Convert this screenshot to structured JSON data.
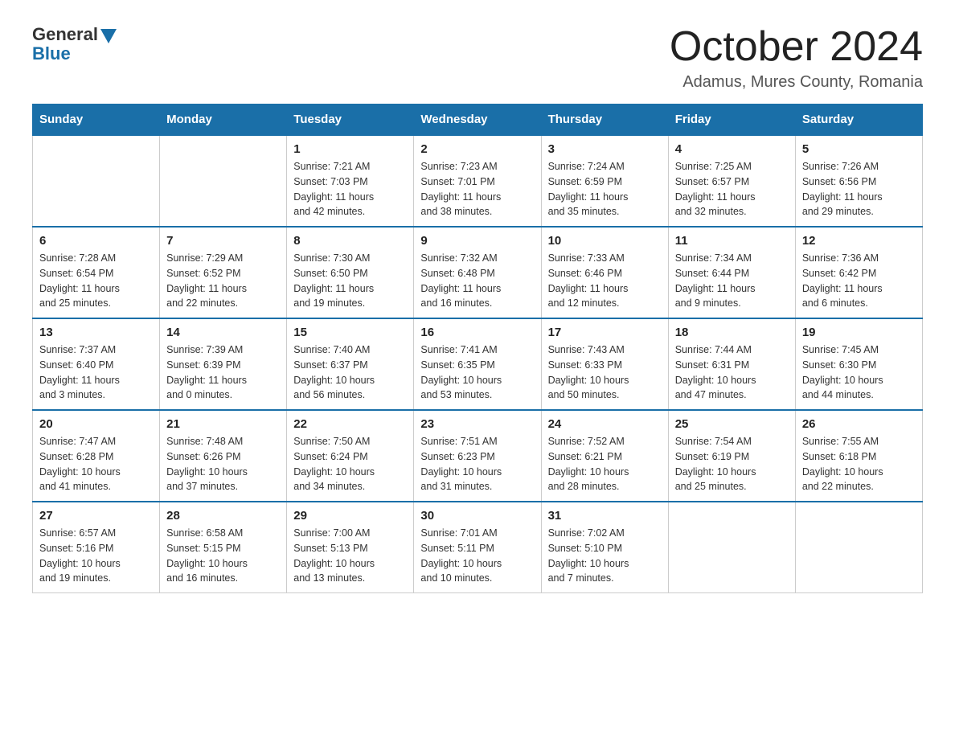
{
  "header": {
    "logo_general": "General",
    "logo_blue": "Blue",
    "title": "October 2024",
    "subtitle": "Adamus, Mures County, Romania"
  },
  "columns": [
    "Sunday",
    "Monday",
    "Tuesday",
    "Wednesday",
    "Thursday",
    "Friday",
    "Saturday"
  ],
  "weeks": [
    [
      {
        "day": "",
        "info": ""
      },
      {
        "day": "",
        "info": ""
      },
      {
        "day": "1",
        "info": "Sunrise: 7:21 AM\nSunset: 7:03 PM\nDaylight: 11 hours\nand 42 minutes."
      },
      {
        "day": "2",
        "info": "Sunrise: 7:23 AM\nSunset: 7:01 PM\nDaylight: 11 hours\nand 38 minutes."
      },
      {
        "day": "3",
        "info": "Sunrise: 7:24 AM\nSunset: 6:59 PM\nDaylight: 11 hours\nand 35 minutes."
      },
      {
        "day": "4",
        "info": "Sunrise: 7:25 AM\nSunset: 6:57 PM\nDaylight: 11 hours\nand 32 minutes."
      },
      {
        "day": "5",
        "info": "Sunrise: 7:26 AM\nSunset: 6:56 PM\nDaylight: 11 hours\nand 29 minutes."
      }
    ],
    [
      {
        "day": "6",
        "info": "Sunrise: 7:28 AM\nSunset: 6:54 PM\nDaylight: 11 hours\nand 25 minutes."
      },
      {
        "day": "7",
        "info": "Sunrise: 7:29 AM\nSunset: 6:52 PM\nDaylight: 11 hours\nand 22 minutes."
      },
      {
        "day": "8",
        "info": "Sunrise: 7:30 AM\nSunset: 6:50 PM\nDaylight: 11 hours\nand 19 minutes."
      },
      {
        "day": "9",
        "info": "Sunrise: 7:32 AM\nSunset: 6:48 PM\nDaylight: 11 hours\nand 16 minutes."
      },
      {
        "day": "10",
        "info": "Sunrise: 7:33 AM\nSunset: 6:46 PM\nDaylight: 11 hours\nand 12 minutes."
      },
      {
        "day": "11",
        "info": "Sunrise: 7:34 AM\nSunset: 6:44 PM\nDaylight: 11 hours\nand 9 minutes."
      },
      {
        "day": "12",
        "info": "Sunrise: 7:36 AM\nSunset: 6:42 PM\nDaylight: 11 hours\nand 6 minutes."
      }
    ],
    [
      {
        "day": "13",
        "info": "Sunrise: 7:37 AM\nSunset: 6:40 PM\nDaylight: 11 hours\nand 3 minutes."
      },
      {
        "day": "14",
        "info": "Sunrise: 7:39 AM\nSunset: 6:39 PM\nDaylight: 11 hours\nand 0 minutes."
      },
      {
        "day": "15",
        "info": "Sunrise: 7:40 AM\nSunset: 6:37 PM\nDaylight: 10 hours\nand 56 minutes."
      },
      {
        "day": "16",
        "info": "Sunrise: 7:41 AM\nSunset: 6:35 PM\nDaylight: 10 hours\nand 53 minutes."
      },
      {
        "day": "17",
        "info": "Sunrise: 7:43 AM\nSunset: 6:33 PM\nDaylight: 10 hours\nand 50 minutes."
      },
      {
        "day": "18",
        "info": "Sunrise: 7:44 AM\nSunset: 6:31 PM\nDaylight: 10 hours\nand 47 minutes."
      },
      {
        "day": "19",
        "info": "Sunrise: 7:45 AM\nSunset: 6:30 PM\nDaylight: 10 hours\nand 44 minutes."
      }
    ],
    [
      {
        "day": "20",
        "info": "Sunrise: 7:47 AM\nSunset: 6:28 PM\nDaylight: 10 hours\nand 41 minutes."
      },
      {
        "day": "21",
        "info": "Sunrise: 7:48 AM\nSunset: 6:26 PM\nDaylight: 10 hours\nand 37 minutes."
      },
      {
        "day": "22",
        "info": "Sunrise: 7:50 AM\nSunset: 6:24 PM\nDaylight: 10 hours\nand 34 minutes."
      },
      {
        "day": "23",
        "info": "Sunrise: 7:51 AM\nSunset: 6:23 PM\nDaylight: 10 hours\nand 31 minutes."
      },
      {
        "day": "24",
        "info": "Sunrise: 7:52 AM\nSunset: 6:21 PM\nDaylight: 10 hours\nand 28 minutes."
      },
      {
        "day": "25",
        "info": "Sunrise: 7:54 AM\nSunset: 6:19 PM\nDaylight: 10 hours\nand 25 minutes."
      },
      {
        "day": "26",
        "info": "Sunrise: 7:55 AM\nSunset: 6:18 PM\nDaylight: 10 hours\nand 22 minutes."
      }
    ],
    [
      {
        "day": "27",
        "info": "Sunrise: 6:57 AM\nSunset: 5:16 PM\nDaylight: 10 hours\nand 19 minutes."
      },
      {
        "day": "28",
        "info": "Sunrise: 6:58 AM\nSunset: 5:15 PM\nDaylight: 10 hours\nand 16 minutes."
      },
      {
        "day": "29",
        "info": "Sunrise: 7:00 AM\nSunset: 5:13 PM\nDaylight: 10 hours\nand 13 minutes."
      },
      {
        "day": "30",
        "info": "Sunrise: 7:01 AM\nSunset: 5:11 PM\nDaylight: 10 hours\nand 10 minutes."
      },
      {
        "day": "31",
        "info": "Sunrise: 7:02 AM\nSunset: 5:10 PM\nDaylight: 10 hours\nand 7 minutes."
      },
      {
        "day": "",
        "info": ""
      },
      {
        "day": "",
        "info": ""
      }
    ]
  ]
}
